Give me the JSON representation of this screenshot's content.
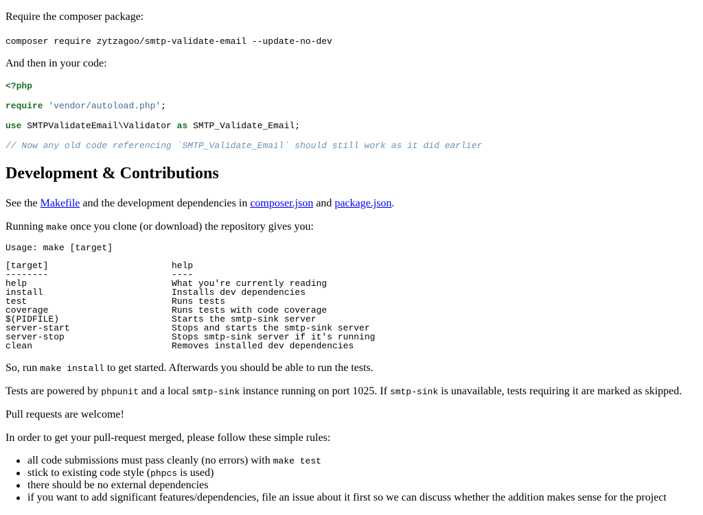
{
  "intro": {
    "require_text": "Require the composer package:",
    "composer_cmd": "composer require zytzagoo/smtp-validate-email --update-no-dev",
    "code_intro": "And then in your code:"
  },
  "code": {
    "php_open": "<?php",
    "require_kw": "require",
    "require_str": "'vendor/autoload.php'",
    "require_end": ";",
    "use_kw": "use",
    "use_class": "SMTPValidateEmail\\Validator",
    "as_kw": "as",
    "alias": "SMTP_Validate_Email;",
    "comment": "// Now any old code referencing `SMTP_Validate_Email` should still work as it did earlier"
  },
  "dev": {
    "heading": "Development & Contributions",
    "see_the": "See the ",
    "makefile_link": "Makefile",
    "deps_in": " and the development dependencies in ",
    "composer_link": "composer.json",
    "and": " and ",
    "package_link": "package.json",
    "period": ".",
    "running": "Running ",
    "make": "make",
    "running_rest": " once you clone (or download) the repository gives you:",
    "usage": "Usage: make [target]",
    "table": {
      "header_target": "[target]",
      "header_help": "help",
      "sep_target": "--------",
      "sep_help": "----",
      "rows": [
        {
          "target": "help",
          "help": "What you're currently reading"
        },
        {
          "target": "install",
          "help": "Installs dev dependencies"
        },
        {
          "target": "test",
          "help": "Runs tests"
        },
        {
          "target": "coverage",
          "help": "Runs tests with code coverage"
        },
        {
          "target": "$(PIDFILE)",
          "help": "Starts the smtp-sink server"
        },
        {
          "target": "server-start",
          "help": "Stops and starts the smtp-sink server"
        },
        {
          "target": "server-stop",
          "help": "Stops smtp-sink server if it's running"
        },
        {
          "target": "clean",
          "help": "Removes installed dev dependencies"
        }
      ]
    },
    "so_run": "So, run ",
    "make_install": "make install",
    "so_rest": " to get started. Afterwards you should be able to run the tests.",
    "tests_a": "Tests are powered by ",
    "phpunit": "phpunit",
    "tests_b": " and a local ",
    "smtp_sink": "smtp-sink",
    "tests_c": " instance running on port 1025. If ",
    "smtp_sink2": "smtp-sink",
    "tests_d": " is unavailable, tests requiring it are marked as skipped.",
    "pull_welcome": "Pull requests are welcome!",
    "rules_intro": "In order to get your pull-request merged, please follow these simple rules:",
    "rules": {
      "r1_text": "all code submissions must pass cleanly (no errors) with ",
      "r1_code": "make test",
      "r2_a": "stick to existing code style (",
      "r2_code": "phpcs",
      "r2_b": " is used)",
      "r3": "there should be no external dependencies",
      "r4": "if you want to add significant features/dependencies, file an issue about it first so we can discuss whether the addition makes sense for the project"
    }
  }
}
